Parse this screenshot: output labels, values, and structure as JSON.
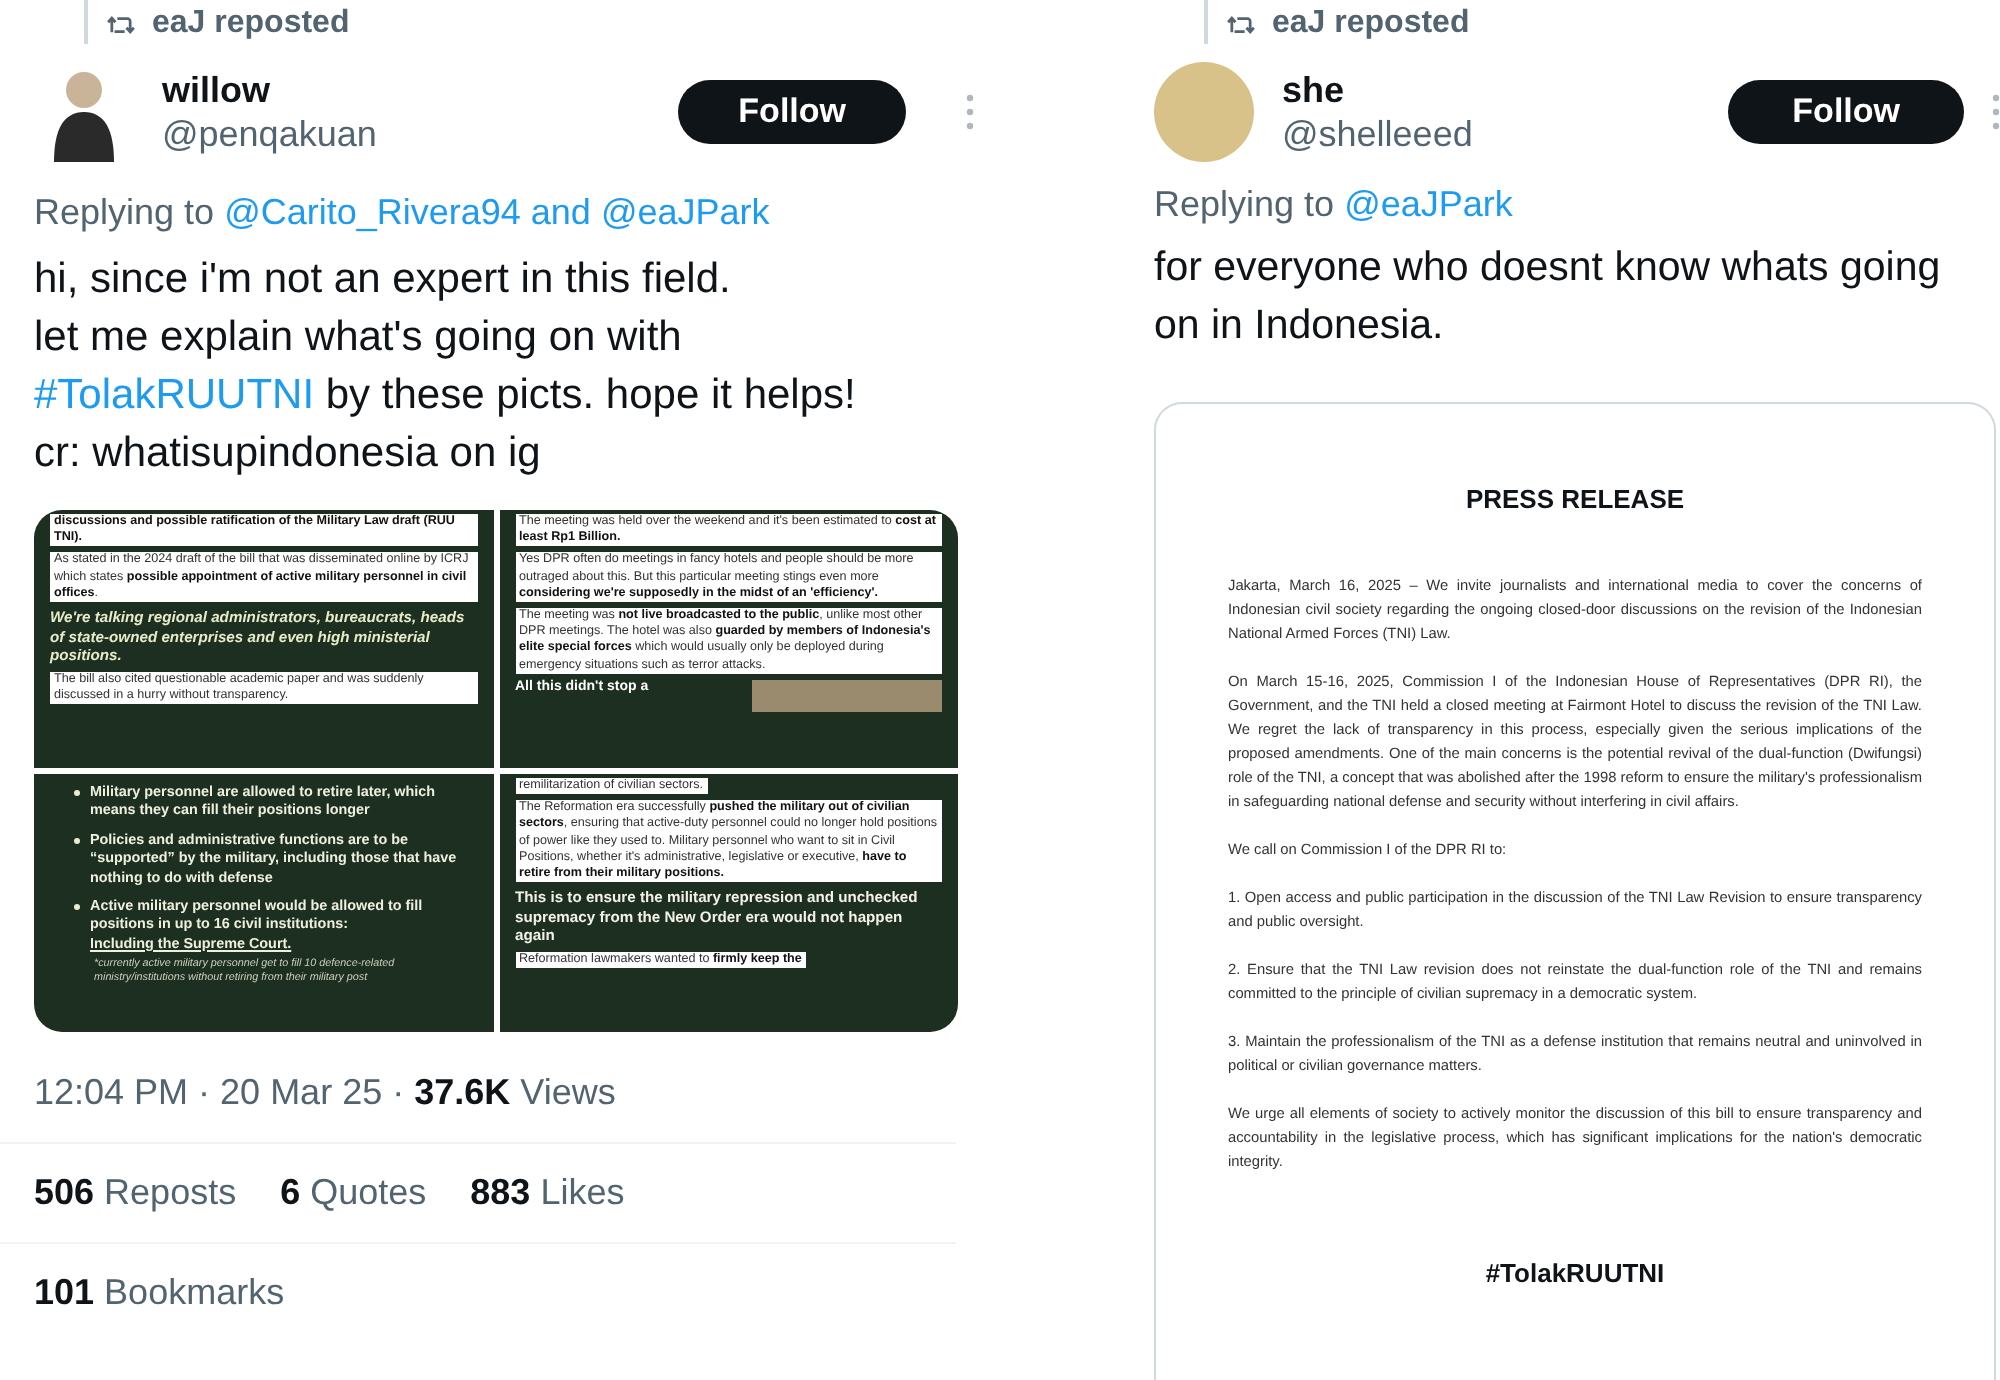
{
  "tweets": [
    {
      "repost_label": "eaJ reposted",
      "author": {
        "name": "willow",
        "handle": "@penqakuan",
        "avatar": {
          "kind": "silhouette"
        }
      },
      "follow_label": "Follow",
      "replying": {
        "prefix": "Replying to",
        "mentions": [
          "@Carito_Rivera94",
          "@eaJPark"
        ],
        "joiner": "and"
      },
      "body": [
        {
          "kind": "text",
          "text": "hi, since i'm not an expert in this field.\nlet me explain what's going on with\n"
        },
        {
          "kind": "hashtag",
          "text": "#TolakRUUTNI"
        },
        {
          "kind": "text",
          "text": " by these picts. hope it helps!\ncr: whatisupindonesia on ig"
        }
      ],
      "attachment": {
        "kind": "slides",
        "slides": [
          {
            "blocks": [
              {
                "kind": "heading_box",
                "text": "discussions and possible ratification of the Military Law draft (RUU TNI)."
              },
              {
                "kind": "boxed",
                "text": "As stated in the 2024 draft of the bill that was disseminated online by ICRJ which states **possible appointment of active military personnel in civil offices**."
              },
              {
                "kind": "lead",
                "text": "We're talking regional administrators, bureaucrats, heads of state-owned enterprises and even high ministerial positions."
              },
              {
                "kind": "boxed",
                "text": "The bill also cited questionable academic paper and was suddenly discussed in a hurry without transparency."
              }
            ]
          },
          {
            "blocks": [
              {
                "kind": "boxed",
                "text": "The meeting was held over the weekend and it's been estimated to **cost at least Rp1 Billion.**"
              },
              {
                "kind": "boxed",
                "text": "Yes DPR often do meetings in fancy hotels and people should be more outraged about this. But this particular meeting stings even more **considering we're supposedly in the midst of an 'efficiency'.**"
              },
              {
                "kind": "boxed",
                "text": "The meeting was **not live broadcasted to the public**, unlike most other DPR meetings. The hotel was also **guarded by members of Indonesia's elite special forces** which would usually only be deployed during emergency situations such as terror attacks."
              },
              {
                "kind": "photo_caption",
                "text": "All this didn't stop a"
              }
            ]
          },
          {
            "blocks": [
              {
                "kind": "bullet",
                "text": "Military personnel are allowed to retire later, which means they can fill their positions longer"
              },
              {
                "kind": "bullet",
                "text": "Policies and administrative functions are to be “supported” by the military, including those that have nothing to do with defense"
              },
              {
                "kind": "bullet",
                "text": "Active military personnel would be allowed to fill positions in up to 16 civil institutions:",
                "emphasis": "Including the Supreme Court."
              },
              {
                "kind": "note",
                "text": "*currently active military personnel get to fill 10 defence-related ministry/institutions without retiring from their military post"
              }
            ]
          },
          {
            "blocks": [
              {
                "kind": "boxed",
                "text": "remilitarization of civilian sectors."
              },
              {
                "kind": "boxed",
                "text": "The Reformation era successfully **pushed the military out of civilian sectors**, ensuring that active-duty personnel could no longer hold positions of power like they used to. Military personnel who want to sit in Civil Positions, whether it's administrative, legislative or executive, **have to retire from their military positions.**"
              },
              {
                "kind": "lead_plain",
                "text": "This is to ensure the military repression and unchecked supremacy from the New Order era would not happen again"
              },
              {
                "kind": "boxed",
                "text": "Reformation lawmakers wanted to **firmly keep the**"
              }
            ]
          }
        ]
      },
      "meta": {
        "time": "12:04 PM · 20 Mar 25 · ",
        "views": "37.6K",
        "views_label": "Views"
      },
      "stats": [
        {
          "count": "506",
          "label": "Reposts"
        },
        {
          "count": "6",
          "label": "Quotes"
        },
        {
          "count": "883",
          "label": "Likes"
        }
      ],
      "bookmarks": {
        "count": "101",
        "label": "Bookmarks"
      }
    },
    {
      "repost_label": "eaJ reposted",
      "author": {
        "name": "she",
        "handle": "@shelleeed",
        "avatar": {
          "kind": "plain"
        }
      },
      "follow_label": "Follow",
      "replying": {
        "prefix": "Replying to",
        "mentions": [
          "@eaJPark"
        ]
      },
      "body": [
        {
          "kind": "text",
          "text": "for everyone who doesnt know whats going on in Indonesia."
        }
      ],
      "attachment": {
        "kind": "document",
        "title": "PRESS RELEASE",
        "paragraphs": [
          "Jakarta, March 16, 2025 – We invite journalists and international media to cover the concerns of Indonesian civil society regarding the ongoing closed-door discussions on the revision of the Indonesian National Armed Forces (TNI) Law.",
          "On March 15-16, 2025, Commission I of the Indonesian House of Representatives (DPR RI), the Government, and the TNI held a closed meeting at Fairmont Hotel to discuss the revision of the TNI Law. We regret the lack of transparency in this process, especially given the serious implications of the proposed amendments. One of the main concerns is the potential revival of the dual-function (Dwifungsi) role of the TNI, a concept that was abolished after the 1998 reform to ensure the military's professionalism in safeguarding national defense and security without interfering in civil affairs.",
          "We call on Commission I of the DPR RI to:",
          "1. Open access and public participation in the discussion of the TNI Law Revision to ensure transparency and public oversight.",
          "2. Ensure that the TNI Law revision does not reinstate the dual-function role of the TNI and remains committed to the principle of civilian supremacy in a democratic system.",
          "3. Maintain the professionalism of the TNI as a defense institution that remains neutral and uninvolved in political or civilian governance matters.",
          "We urge all elements of society to actively monitor the discussion of this bill to ensure transparency and accountability in the legislative process, which has significant implications for the nation's democratic integrity."
        ],
        "hashtag": "#TolakRUUTNI"
      }
    }
  ]
}
